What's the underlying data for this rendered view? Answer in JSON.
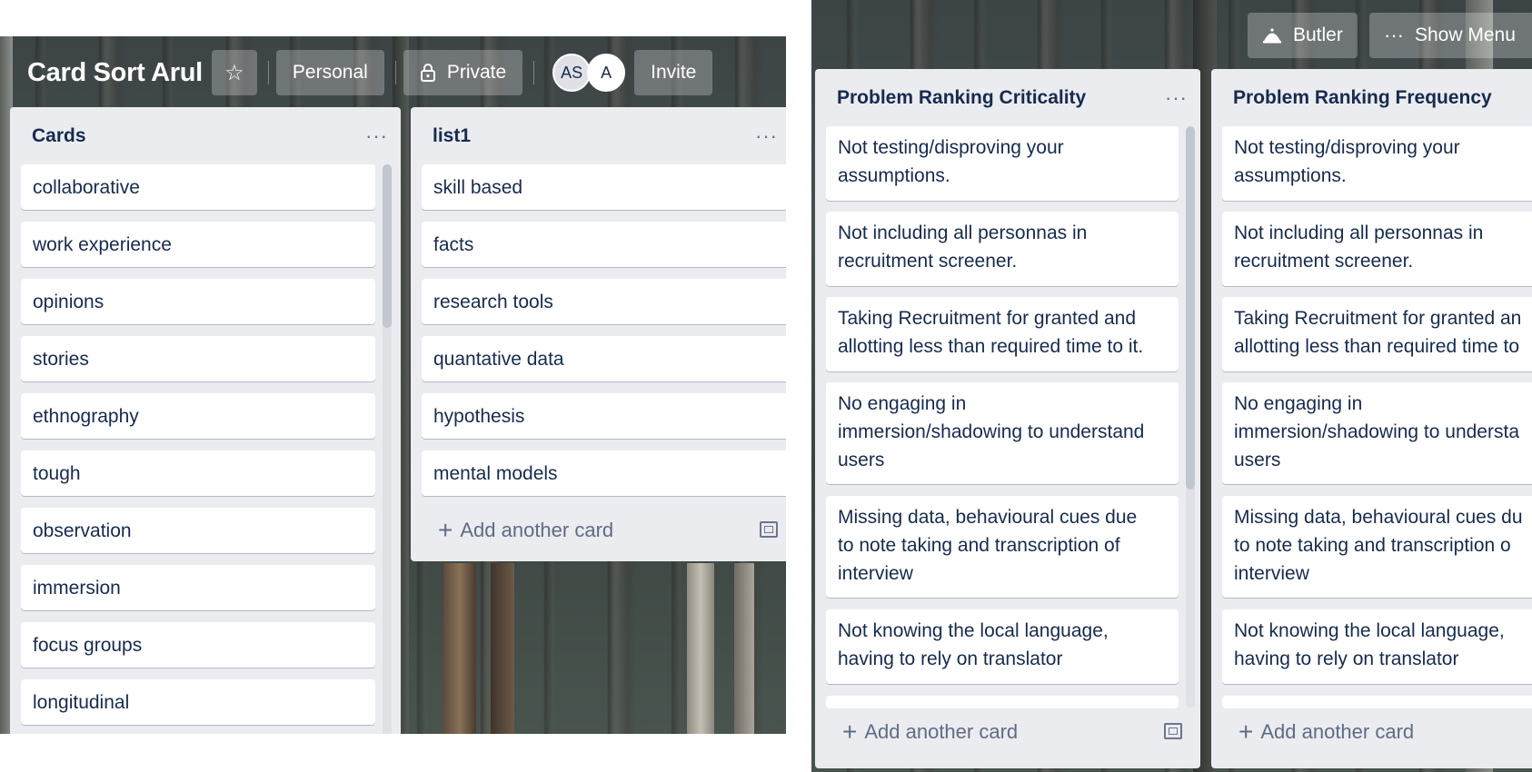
{
  "left_board": {
    "title": "Card Sort Arul",
    "star_icon": "star-icon",
    "personal_label": "Personal",
    "private_label": "Private",
    "avatars": [
      "AS",
      "A"
    ],
    "invite_label": "Invite",
    "lists": [
      {
        "title": "Cards",
        "menu": "···",
        "cards": [
          "collaborative",
          "work experience",
          "opinions",
          "stories",
          "ethnography",
          "tough",
          "observation",
          "immersion",
          "focus groups",
          "longitudinal"
        ]
      },
      {
        "title": "list1",
        "menu": "···",
        "cards": [
          "skill based",
          "facts",
          "research tools",
          "quantative data",
          "hypothesis",
          "mental models"
        ],
        "add_card_label": "Add another card"
      }
    ]
  },
  "right_board": {
    "butler_label": "Butler",
    "show_menu_label": "Show Menu",
    "lists": [
      {
        "title": "Problem Ranking Criticality",
        "menu": "···",
        "cards": [
          [
            "Not testing/disproving your",
            "assumptions."
          ],
          [
            "Not including all personnas in",
            "recruitment screener."
          ],
          [
            "Taking Recruitment for granted and",
            "allotting less than required time to it."
          ],
          [
            "No engaging in",
            "immersion/shadowing to understand",
            "users"
          ],
          [
            "Missing data, behavioural cues due",
            "to note taking and transcription of",
            "interview"
          ],
          [
            "Not knowing the local language,",
            "having to rely on translator"
          ]
        ],
        "add_card_label": "Add another card"
      },
      {
        "title": "Problem Ranking Frequency",
        "menu": "",
        "cards": [
          [
            "Not testing/disproving your",
            "assumptions."
          ],
          [
            "Not including all personnas in",
            "recruitment screener."
          ],
          [
            "Taking Recruitment for granted an",
            "allotting less than required time to"
          ],
          [
            "No engaging in",
            "immersion/shadowing to understa",
            "users"
          ],
          [
            "Missing data, behavioural cues du",
            "to note taking and transcription o",
            "interview"
          ],
          [
            "Not knowing the local language,",
            "having to rely on translator"
          ]
        ],
        "add_card_label": "Add another card"
      }
    ]
  }
}
